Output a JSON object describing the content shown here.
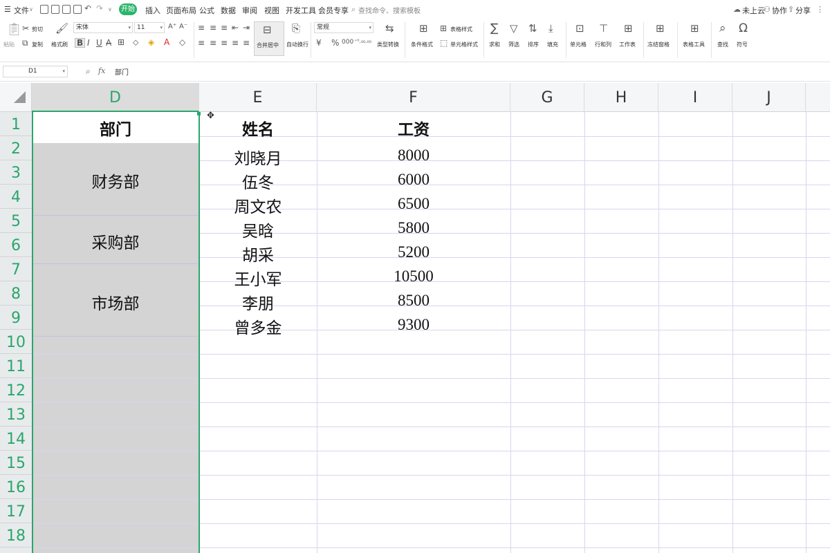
{
  "menu": {
    "file_label": "文件",
    "tabs": [
      "开始",
      "插入",
      "页面布局",
      "公式",
      "数据",
      "审阅",
      "视图",
      "开发工具",
      "会员专享"
    ],
    "search_placeholder": "查找命令、搜索模板",
    "right": {
      "cloud": "未上云",
      "collab": "协作",
      "share": "分享"
    }
  },
  "ribbon": {
    "paste": "粘贴",
    "cut": "剪切",
    "copy": "复制",
    "format_painter": "格式刷",
    "font_name": "宋体",
    "font_size": "11",
    "merge_center": "合并居中",
    "wrap_text": "自动换行",
    "number_format": "常规",
    "type_convert": "类型转换",
    "conditional_format": "条件格式",
    "table_style": "表格样式",
    "cell_style": "单元格样式",
    "sum": "求和",
    "filter": "筛选",
    "sort": "排序",
    "fill": "填充",
    "cell": "单元格",
    "row_col": "行和列",
    "worksheet": "工作表",
    "freeze": "冻结窗格",
    "table_tools": "表格工具",
    "find": "查找",
    "symbol": "符号"
  },
  "formula_bar": {
    "name_box": "D1",
    "fx": "fx",
    "content": "部门"
  },
  "columns": [
    "D",
    "E",
    "F",
    "G",
    "H",
    "I",
    "J"
  ],
  "rows": [
    "1",
    "2",
    "3",
    "4",
    "5",
    "6",
    "7",
    "8",
    "9",
    "10",
    "11",
    "12",
    "13",
    "14",
    "15",
    "16",
    "17",
    "18"
  ],
  "table": {
    "headers": {
      "dept": "部门",
      "name": "姓名",
      "salary": "工资"
    },
    "departments": [
      "财务部",
      "采购部",
      "市场部"
    ],
    "names": [
      "刘晓月",
      "伍冬",
      "周文农",
      "吴晗",
      "胡采",
      "王小军",
      "李朋",
      "曾多金"
    ],
    "salaries": [
      "8000",
      "6000",
      "6500",
      "5800",
      "5200",
      "10500",
      "8500",
      "9300"
    ]
  },
  "colors": {
    "accent": "#2cb46b",
    "row_header_text": "#2aa66c",
    "selection": "#d4d4d4",
    "gridline": "#d6d6ee"
  }
}
